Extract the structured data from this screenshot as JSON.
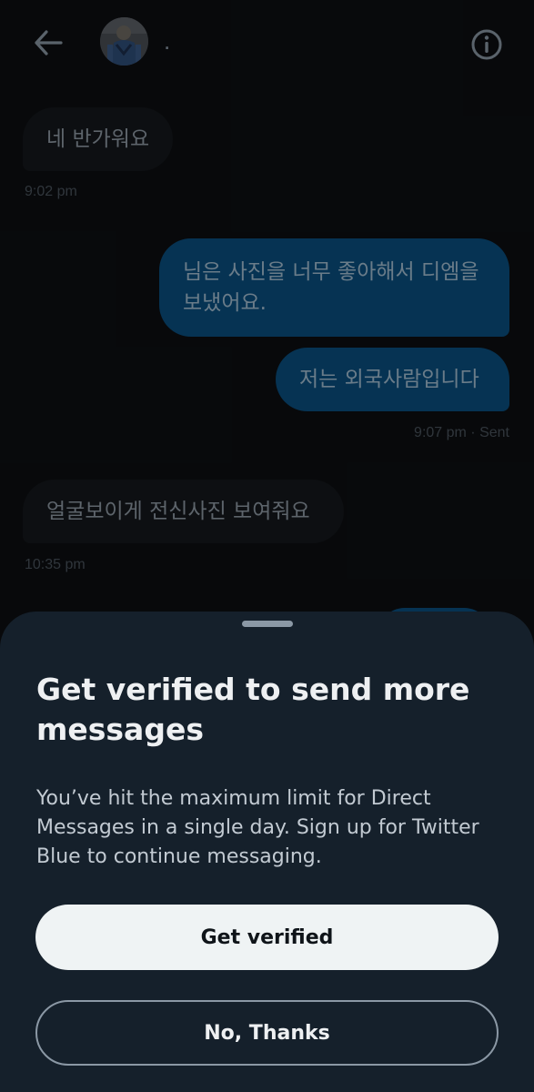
{
  "header": {
    "back_icon": "arrow-left-icon",
    "avatar_icon": "avatar",
    "name": ".",
    "info_icon": "info-icon"
  },
  "messages": [
    {
      "direction": "received",
      "text": "네 반가워요",
      "meta": "9:02 pm"
    },
    {
      "direction": "sent",
      "text_line1": "님은 사진을 너무 좋아해서 디엠을",
      "text_line2": "보냈어요."
    },
    {
      "direction": "sent",
      "text": "저는 외국사람입니다",
      "meta": "9:07 pm · Sent"
    },
    {
      "direction": "received",
      "text": "얼굴보이게 전신사진 보여줘요",
      "meta": "10:35 pm"
    }
  ],
  "sheet": {
    "title": "Get verified to send more messages",
    "body": "You’ve hit the maximum limit for Direct Messages in a single day. Sign up for Twitter Blue to continue messaging.",
    "primary_label": "Get verified",
    "secondary_label": "No, Thanks"
  },
  "colors": {
    "background": "#0d0f12",
    "sent_bubble": "#0a4f80",
    "received_bubble": "#15181c",
    "sheet": "#15202b",
    "primary_button": "#eff3f4"
  }
}
